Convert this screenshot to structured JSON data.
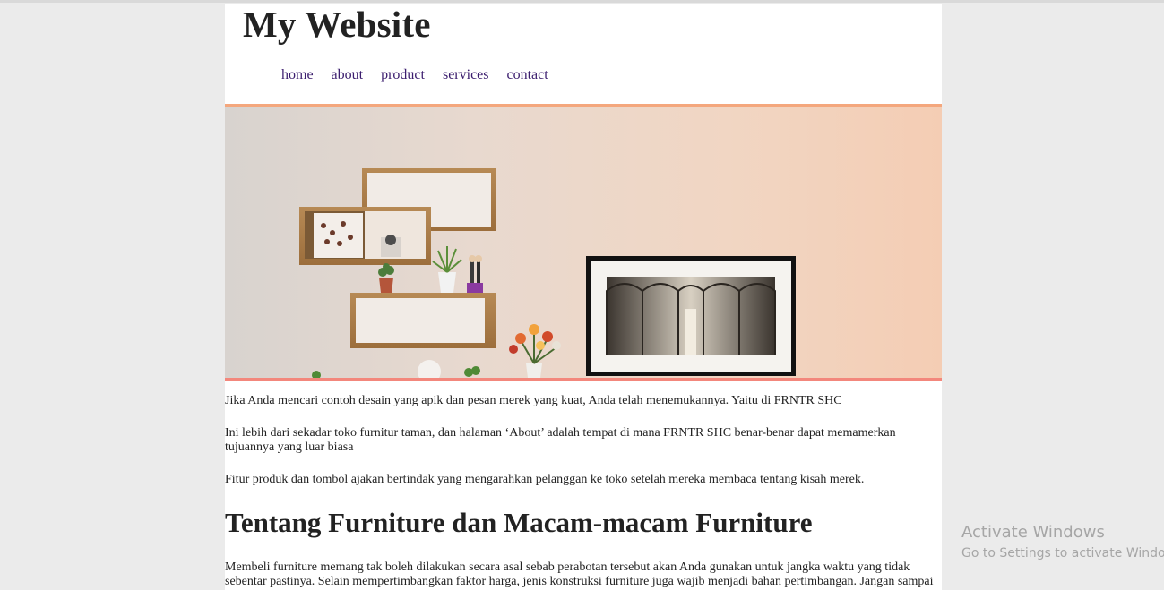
{
  "site": {
    "title": "My Website"
  },
  "nav": {
    "items": [
      {
        "label": "home"
      },
      {
        "label": "about"
      },
      {
        "label": "product"
      },
      {
        "label": "services"
      },
      {
        "label": "contact"
      }
    ],
    "link_color": "#3b1d6e"
  },
  "hero": {
    "border_top_color": "#f4a77d",
    "border_bottom_color": "#f3877c"
  },
  "content": {
    "p1": "Jika Anda mencari contoh desain yang apik dan pesan merek yang kuat, Anda telah menemukannya. Yaitu di FRNTR SHC",
    "p2": "Ini lebih dari sekadar toko furnitur taman, dan halaman ‘About’ adalah tempat di mana FRNTR SHC benar-benar dapat memamerkan tujuannya yang luar biasa",
    "p3": "Fitur produk dan tombol ajakan bertindak yang mengarahkan pelanggan ke toko setelah mereka membaca tentang kisah merek.",
    "heading": "Tentang Furniture dan Macam-macam Furniture",
    "p4": "Membeli furniture memang tak boleh dilakukan secara asal sebab perabotan tersebut akan Anda gunakan untuk jangka waktu yang tidak sebentar pastinya. Selain mempertimbangkan faktor harga, jenis konstruksi furniture juga wajib menjadi bahan pertimbangan. Jangan sampai"
  },
  "watermark": {
    "line1": "Activate Windows",
    "line2": "Go to Settings to activate Windows."
  }
}
